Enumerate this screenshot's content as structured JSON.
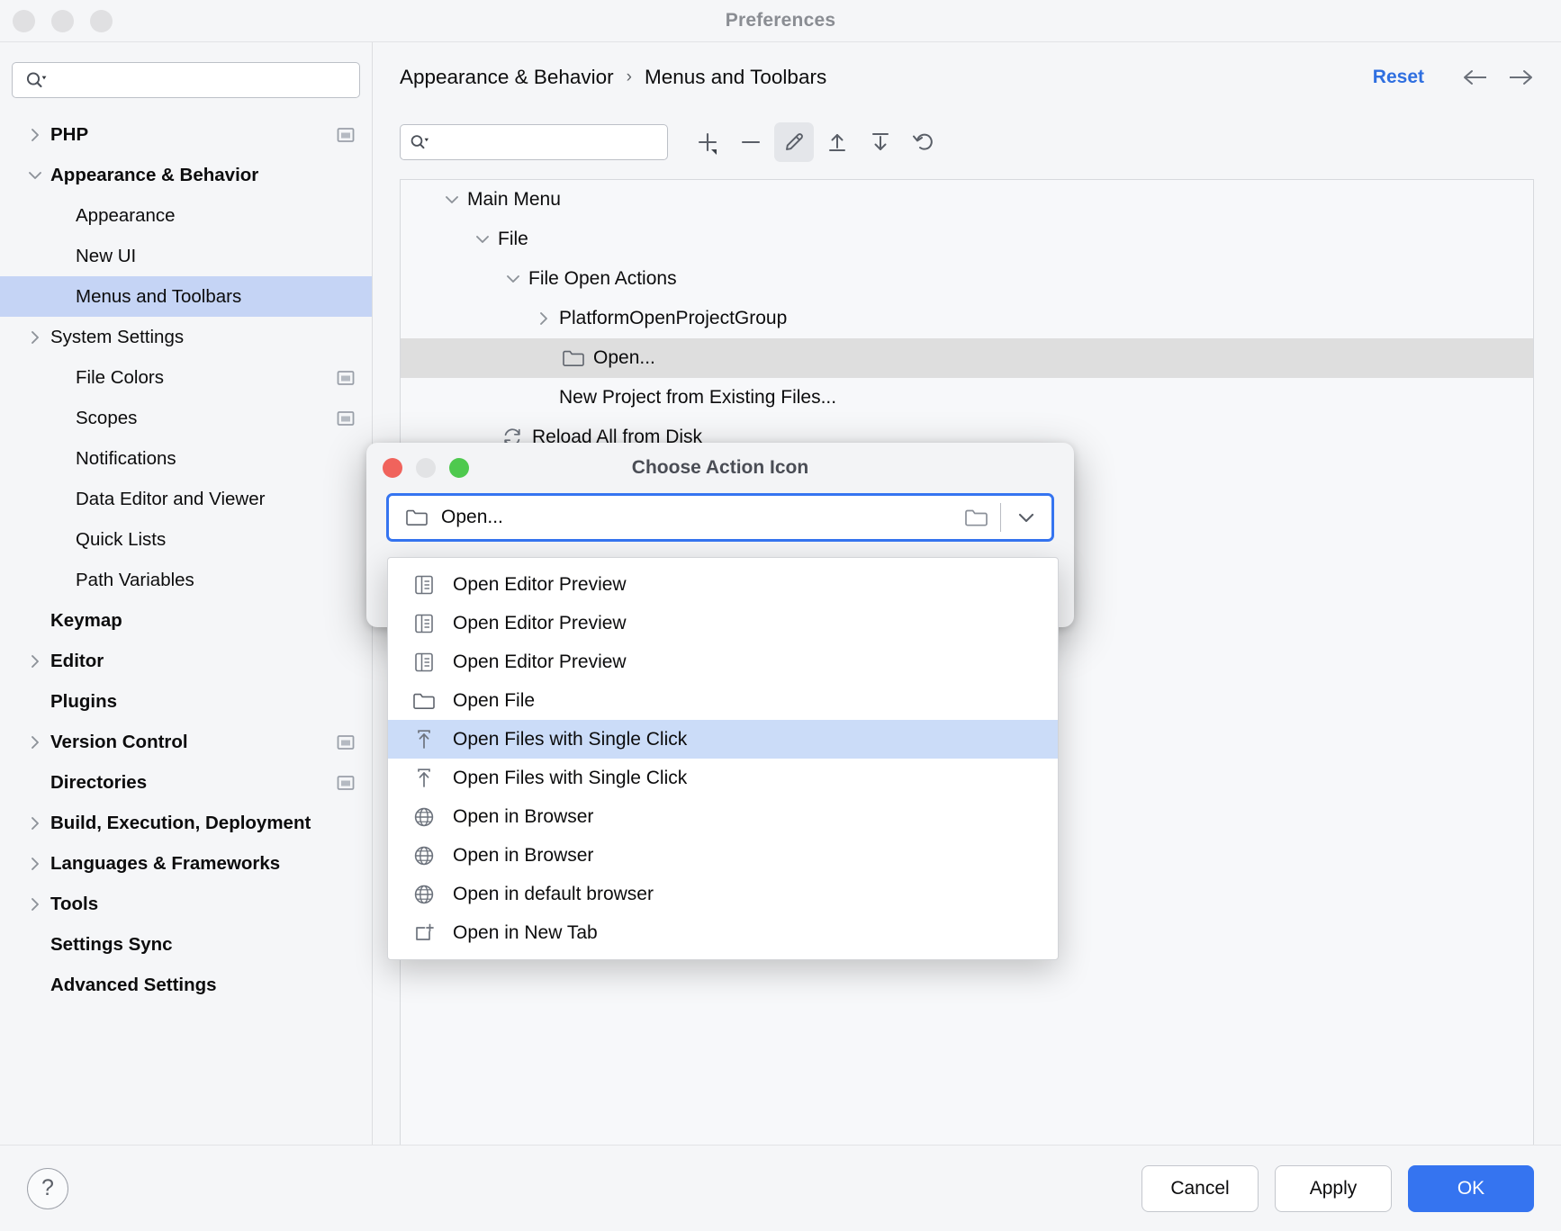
{
  "window": {
    "title": "Preferences",
    "traffic_lights": [
      "close",
      "minimize",
      "maximize"
    ]
  },
  "sidebar": {
    "search": {
      "value": "",
      "placeholder": ""
    },
    "items": [
      {
        "label": "PHP",
        "indent": 0,
        "bold": true,
        "arrow": "right",
        "badge": true
      },
      {
        "label": "Appearance & Behavior",
        "indent": 0,
        "bold": true,
        "arrow": "down",
        "badge": false
      },
      {
        "label": "Appearance",
        "indent": 1,
        "bold": false,
        "arrow": "none",
        "badge": false
      },
      {
        "label": "New UI",
        "indent": 1,
        "bold": false,
        "arrow": "none",
        "badge": false
      },
      {
        "label": "Menus and Toolbars",
        "indent": 1,
        "bold": false,
        "arrow": "none",
        "badge": false,
        "selected": true
      },
      {
        "label": "System Settings",
        "indent": 1,
        "bold": false,
        "arrow": "right",
        "badge": false
      },
      {
        "label": "File Colors",
        "indent": 1,
        "bold": false,
        "arrow": "none",
        "badge": true
      },
      {
        "label": "Scopes",
        "indent": 1,
        "bold": false,
        "arrow": "none",
        "badge": true
      },
      {
        "label": "Notifications",
        "indent": 1,
        "bold": false,
        "arrow": "none",
        "badge": false
      },
      {
        "label": "Data Editor and Viewer",
        "indent": 1,
        "bold": false,
        "arrow": "none",
        "badge": false
      },
      {
        "label": "Quick Lists",
        "indent": 1,
        "bold": false,
        "arrow": "none",
        "badge": false
      },
      {
        "label": "Path Variables",
        "indent": 1,
        "bold": false,
        "arrow": "none",
        "badge": false
      },
      {
        "label": "Keymap",
        "indent": 0,
        "bold": true,
        "arrow": "none",
        "badge": false
      },
      {
        "label": "Editor",
        "indent": 0,
        "bold": true,
        "arrow": "right",
        "badge": false
      },
      {
        "label": "Plugins",
        "indent": 0,
        "bold": true,
        "arrow": "none",
        "badge": false
      },
      {
        "label": "Version Control",
        "indent": 0,
        "bold": true,
        "arrow": "right",
        "badge": true
      },
      {
        "label": "Directories",
        "indent": 0,
        "bold": true,
        "arrow": "none",
        "badge": true
      },
      {
        "label": "Build, Execution, Deployment",
        "indent": 0,
        "bold": true,
        "arrow": "right",
        "badge": false
      },
      {
        "label": "Languages & Frameworks",
        "indent": 0,
        "bold": true,
        "arrow": "right",
        "badge": false
      },
      {
        "label": "Tools",
        "indent": 0,
        "bold": true,
        "arrow": "right",
        "badge": false
      },
      {
        "label": "Settings Sync",
        "indent": 0,
        "bold": true,
        "arrow": "none",
        "badge": false
      },
      {
        "label": "Advanced Settings",
        "indent": 0,
        "bold": true,
        "arrow": "none",
        "badge": false
      }
    ]
  },
  "main": {
    "breadcrumb": {
      "parent": "Appearance & Behavior",
      "separator": "›",
      "current": "Menus and Toolbars"
    },
    "reset_label": "Reset",
    "nav": {
      "back": "back-arrow",
      "forward": "forward-arrow"
    },
    "toolbar": {
      "search": {
        "value": "",
        "placeholder": ""
      },
      "buttons": [
        {
          "name": "add-button",
          "icon": "plus-dropdown-icon",
          "active": false
        },
        {
          "name": "remove-button",
          "icon": "minus-icon",
          "active": false
        },
        {
          "name": "edit-button",
          "icon": "pencil-icon",
          "active": true
        },
        {
          "name": "move-up-button",
          "icon": "arrow-up-icon",
          "active": false
        },
        {
          "name": "move-down-button",
          "icon": "arrow-down-icon",
          "active": false
        },
        {
          "name": "restore-button",
          "icon": "revert-icon",
          "active": false
        }
      ]
    },
    "tree": [
      {
        "label": "Main Menu",
        "depth": 0,
        "arrow": "down",
        "icon": "none"
      },
      {
        "label": "File",
        "depth": 1,
        "arrow": "down",
        "icon": "none"
      },
      {
        "label": "File Open Actions",
        "depth": 2,
        "arrow": "down",
        "icon": "none"
      },
      {
        "label": "PlatformOpenProjectGroup",
        "depth": 3,
        "arrow": "right",
        "icon": "none"
      },
      {
        "label": "Open...",
        "depth": 3,
        "arrow": "none",
        "icon": "folder-icon",
        "selected": true
      },
      {
        "label": "New Project from Existing Files...",
        "depth": 3,
        "arrow": "none",
        "icon": "none"
      },
      {
        "label": "Reload All from Disk",
        "depth": 2,
        "arrow": "none",
        "icon": "refresh-icon"
      }
    ]
  },
  "footer": {
    "help_label": "?",
    "buttons": [
      {
        "label": "Cancel",
        "primary": false
      },
      {
        "label": "Apply",
        "primary": false
      },
      {
        "label": "OK",
        "primary": true
      }
    ]
  },
  "modal": {
    "title": "Choose Action Icon",
    "traffic_lights": [
      "close",
      "minimize",
      "maximize"
    ],
    "combo": {
      "value": "Open...",
      "value_icon": "folder-icon",
      "browse_icon": "folder-icon",
      "chevron_icon": "chevron-down-icon"
    },
    "dropdown": {
      "items": [
        {
          "label": "Open Editor Preview",
          "icon": "editor-preview-icon",
          "selected": false
        },
        {
          "label": "Open Editor Preview",
          "icon": "editor-preview-icon",
          "selected": false
        },
        {
          "label": "Open Editor Preview",
          "icon": "editor-preview-icon",
          "selected": false
        },
        {
          "label": "Open File",
          "icon": "folder-icon",
          "selected": false
        },
        {
          "label": "Open Files with Single Click",
          "icon": "open-in-icon",
          "selected": true
        },
        {
          "label": "Open Files with Single Click",
          "icon": "open-in-icon",
          "selected": false
        },
        {
          "label": "Open in Browser",
          "icon": "globe-icon",
          "selected": false
        },
        {
          "label": "Open in Browser",
          "icon": "globe-icon",
          "selected": false
        },
        {
          "label": "Open in default browser",
          "icon": "globe-icon",
          "selected": false
        },
        {
          "label": "Open in New Tab",
          "icon": "new-tab-icon",
          "selected": false
        }
      ]
    }
  },
  "colors": {
    "accent": "#3574f0",
    "selection_blue": "#c5d4f5",
    "dropdown_selection": "#cbdcf8",
    "tree_selection": "#dedede",
    "window_bg": "#f5f6f8"
  }
}
